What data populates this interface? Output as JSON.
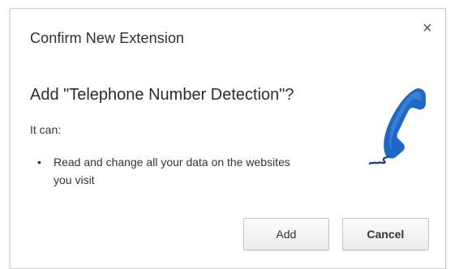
{
  "dialog": {
    "title": "Confirm New Extension",
    "close_glyph": "×",
    "heading": "Add \"Telephone Number Detection\"?",
    "intro": "It can:",
    "permissions": [
      "Read and change all your data on the websites you visit"
    ],
    "bullet": "•",
    "icon": "telephone-handset-icon",
    "buttons": {
      "add_label": "Add",
      "cancel_label": "Cancel"
    }
  },
  "colors": {
    "icon_blue": "#1f67c4",
    "icon_dark": "#0e3f86",
    "border": "#cfcfcf",
    "text": "#333333"
  }
}
